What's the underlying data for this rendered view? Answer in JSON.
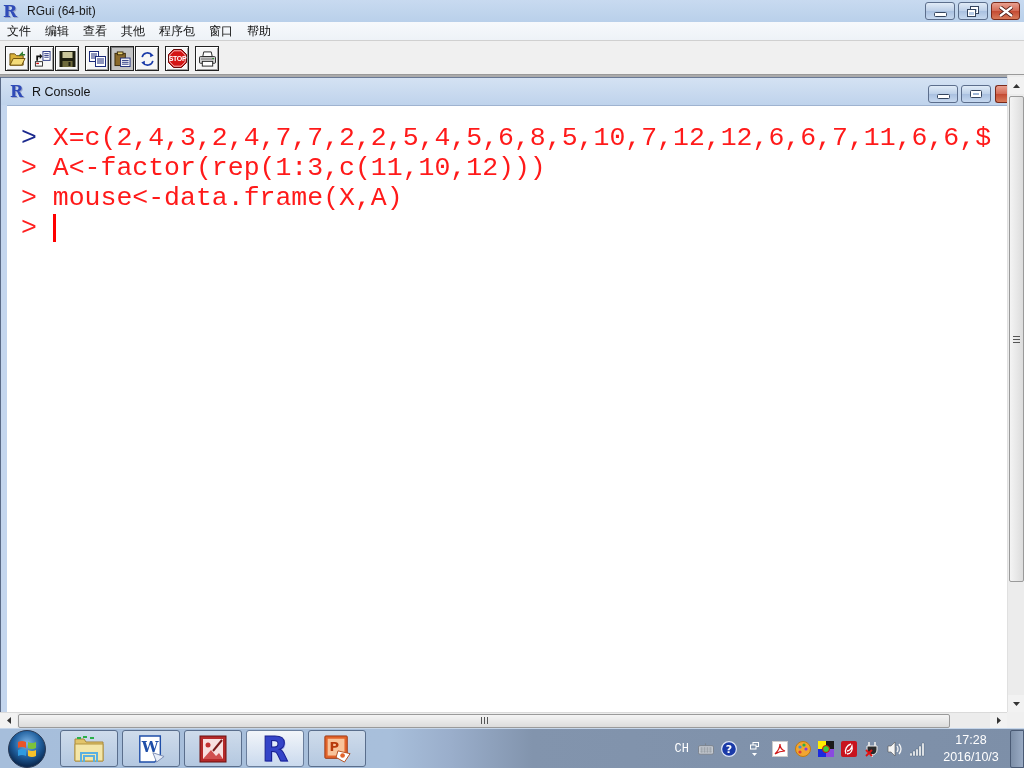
{
  "window": {
    "logo": "R",
    "title": "RGui (64-bit)",
    "controls": [
      {
        "kind": "minimize"
      },
      {
        "kind": "restore"
      },
      {
        "kind": "close"
      }
    ]
  },
  "menu": [
    "文件",
    "编辑",
    "查看",
    "其他",
    "程序包",
    "窗口",
    "帮助"
  ],
  "toolbar": [
    [
      {
        "kind": "open",
        "pressed": false
      },
      {
        "kind": "load",
        "pressed": false
      },
      {
        "kind": "save",
        "pressed": false
      }
    ],
    [
      {
        "kind": "copy",
        "pressed": false
      },
      {
        "kind": "paste",
        "pressed": true
      },
      {
        "kind": "copy-paste",
        "pressed": false
      }
    ],
    [
      {
        "kind": "stop",
        "label": "STOP",
        "pressed": false
      }
    ],
    [
      {
        "kind": "print",
        "pressed": false
      }
    ]
  ],
  "console_window": {
    "logo": "R",
    "title": "R Console",
    "controls": [
      {
        "kind": "minimize"
      },
      {
        "kind": "maximize"
      },
      {
        "kind": "close"
      }
    ],
    "lines": [
      {
        "prompt": ">",
        "color": "#1c2a8e",
        "text": "X=c(2,4,3,2,4,7,7,2,2,5,4,5,6,8,5,10,7,12,12,6,6,7,11,6,6,$"
      },
      {
        "prompt": ">",
        "color": "#ff2020",
        "text": "A<-factor(rep(1:3,c(11,10,12)))"
      },
      {
        "prompt": ">",
        "color": "#ff2020",
        "text": "mouse<-data.frame(X,A)"
      }
    ],
    "input_line": {
      "prompt": ">",
      "color": "#ff2020",
      "cursor": true
    }
  },
  "taskbar": {
    "apps": [
      {
        "kind": "folder",
        "selected": false
      },
      {
        "kind": "document",
        "letter": "W",
        "selected": false
      },
      {
        "kind": "picture",
        "selected": false
      },
      {
        "kind": "app",
        "letter": "R",
        "selected": true
      },
      {
        "kind": "presentation",
        "letter": "P",
        "selected": false
      }
    ],
    "tray": [
      {
        "kind": "language",
        "label": "CH"
      },
      {
        "kind": "keyboard"
      },
      {
        "kind": "help",
        "label": "?"
      },
      {
        "kind": "overflow"
      },
      {
        "kind": "pdf"
      },
      {
        "kind": "palette"
      },
      {
        "kind": "color-grid"
      },
      {
        "kind": "swirl"
      },
      {
        "kind": "plug"
      },
      {
        "kind": "speaker"
      },
      {
        "kind": "signal"
      }
    ],
    "clock": {
      "time": "17:28",
      "date": "2016/10/3"
    }
  }
}
